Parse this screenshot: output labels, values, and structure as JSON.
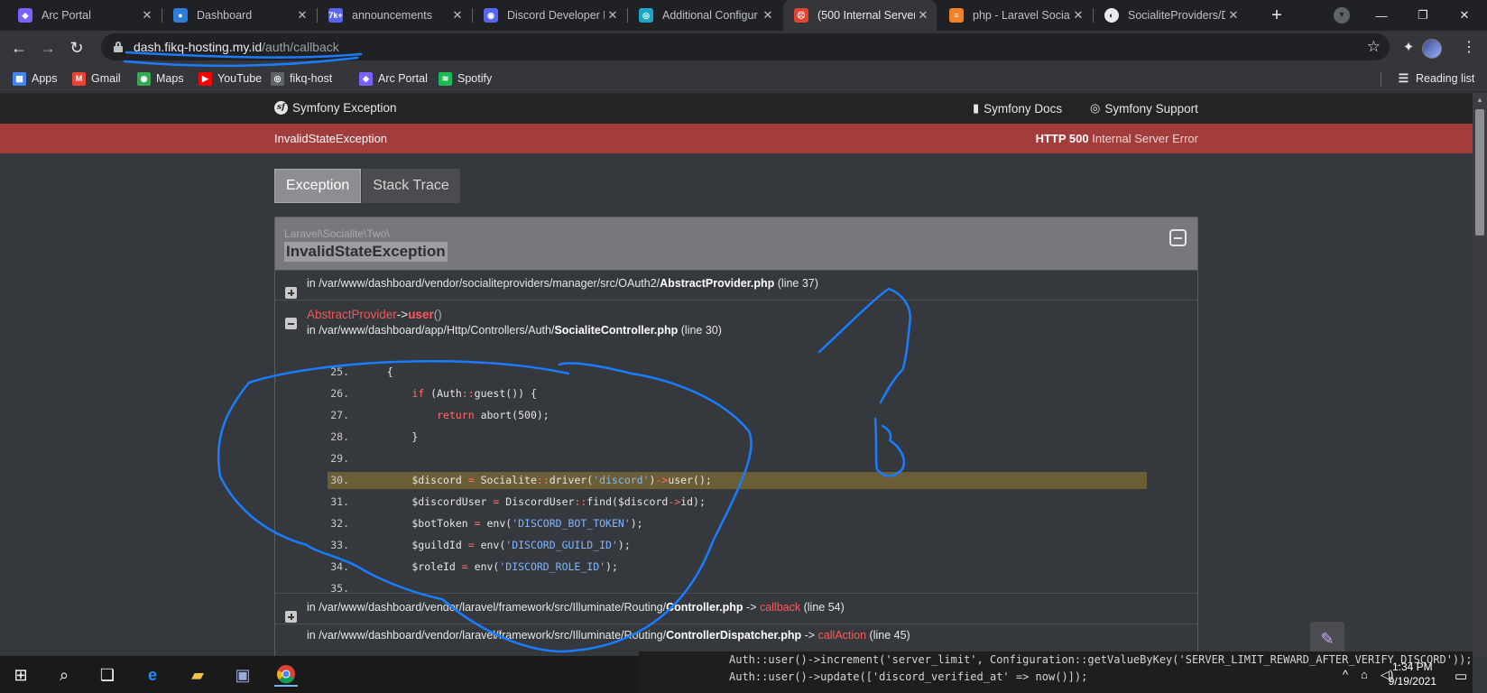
{
  "browser": {
    "tabs": [
      {
        "title": "Arc Portal",
        "fav_color": "#7b61ff",
        "fav_glyph": "◆",
        "icon": "arc-portal-icon"
      },
      {
        "title": "Dashboard",
        "fav_color": "#2f7bd8",
        "fav_glyph": "●",
        "icon": "dashboard-icon"
      },
      {
        "title": "announcements",
        "fav_color": "#5865f2",
        "fav_glyph": "7k+",
        "icon": "discord-icon"
      },
      {
        "title": "Discord Developer P",
        "fav_color": "#5865f2",
        "fav_glyph": "◉",
        "icon": "discord-icon"
      },
      {
        "title": "Additional Configur",
        "fav_color": "#1aa6c9",
        "fav_glyph": "◎",
        "icon": "docs-icon"
      },
      {
        "title": "(500 Internal Server",
        "fav_color": "#e0452f",
        "fav_glyph": "☹",
        "icon": "error-icon"
      },
      {
        "title": "php - Laravel Sociali",
        "fav_color": "#f48024",
        "fav_glyph": "≡",
        "icon": "stackoverflow-icon"
      },
      {
        "title": "SocialiteProviders/D",
        "fav_color": "#e8eaed",
        "fav_glyph": "◐",
        "icon": "github-icon"
      }
    ],
    "new_tab": "+",
    "url_host": "dash.fikq-hosting.my.id",
    "url_path": "/auth/callback",
    "bookmarks": [
      {
        "label": "Apps",
        "color": "#4285f4",
        "glyph": "▦"
      },
      {
        "label": "Gmail",
        "color": "#ea4335",
        "glyph": "M"
      },
      {
        "label": "Maps",
        "color": "#34a853",
        "glyph": "◉"
      },
      {
        "label": "YouTube",
        "color": "#ff0000",
        "glyph": "▶"
      },
      {
        "label": "fikq-host",
        "color": "#5f6368",
        "glyph": "◎"
      },
      {
        "label": "Arc Portal",
        "color": "#7b61ff",
        "glyph": "◆"
      },
      {
        "label": "Spotify",
        "color": "#1db954",
        "glyph": "≋"
      }
    ],
    "reading_list": "Reading list"
  },
  "symfony": {
    "brand": "Symfony Exception",
    "docs": "Symfony Docs",
    "support": "Symfony Support",
    "error_class": "InvalidStateException",
    "status_code": "HTTP 500",
    "status_text": "Internal Server Error",
    "tab_exception": "Exception",
    "tab_stack": "Stack Trace",
    "namespace": "Laravel\\Socialite\\Two\\",
    "exception_title": "InvalidStateException"
  },
  "trace": [
    {
      "prefix": "in /var/www/dashboard/vendor/socialiteproviders/manager/src/OAuth2/",
      "file": "AbstractProvider.php",
      "suffix": "(line 37)"
    },
    {
      "cls": "AbstractProvider",
      "arrow": "->",
      "method": "user",
      "parens": "()",
      "prefix": "in /var/www/dashboard/app/Http/Controllers/Auth/",
      "file": "SocialiteController.php",
      "suffix": "(line 30)"
    },
    {
      "prefix": "in /var/www/dashboard/vendor/laravel/framework/src/Illuminate/Routing/",
      "file": "Controller.php",
      "arrow": "->",
      "method": "callback",
      "suffix": "(line 54)"
    },
    {
      "prefix": "in /var/www/dashboard/vendor/laravel/framework/src/Illuminate/Routing/",
      "file": "ControllerDispatcher.php",
      "arrow": "->",
      "method": "callAction",
      "suffix": "(line 45)"
    }
  ],
  "code": [
    {
      "n": "25.",
      "html": "    {"
    },
    {
      "n": "26.",
      "html": "        <span class='kw'>if</span> (Auth<span class='op'>::</span>guest()) {"
    },
    {
      "n": "27.",
      "html": "            <span class='kw'>return</span> abort(500);"
    },
    {
      "n": "28.",
      "html": "        }"
    },
    {
      "n": "29.",
      "html": ""
    },
    {
      "n": "30.",
      "html": "        $discord <span class='op'>=</span> Socialite<span class='op'>::</span>driver(<span class='str'>'discord'</span>)<span class='op'>-&gt;</span>user();",
      "hl": true
    },
    {
      "n": "31.",
      "html": "        $discordUser <span class='op'>=</span> DiscordUser<span class='op'>::</span>find($discord<span class='op'>-&gt;</span>id);"
    },
    {
      "n": "32.",
      "html": "        $botToken <span class='op'>=</span> env(<span class='str'>'DISCORD_BOT_TOKEN'</span>);"
    },
    {
      "n": "33.",
      "html": "        $guildId <span class='op'>=</span> env(<span class='str'>'DISCORD_GUILD_ID'</span>);"
    },
    {
      "n": "34.",
      "html": "        $roleId <span class='op'>=</span> env(<span class='str'>'DISCORD_ROLE_ID'</span>);"
    },
    {
      "n": "35.",
      "html": ""
    }
  ],
  "background_editor": [
    "Auth::user()->increment('server_limit', Configuration::getValueByKey('SERVER_LIMIT_REWARD_AFTER_VERIFY_DISCORD'));",
    "Auth::user()->update(['discord_verified_at' => now()]);"
  ],
  "taskbar": {
    "time": "1:34 PM",
    "date": "9/19/2021"
  }
}
